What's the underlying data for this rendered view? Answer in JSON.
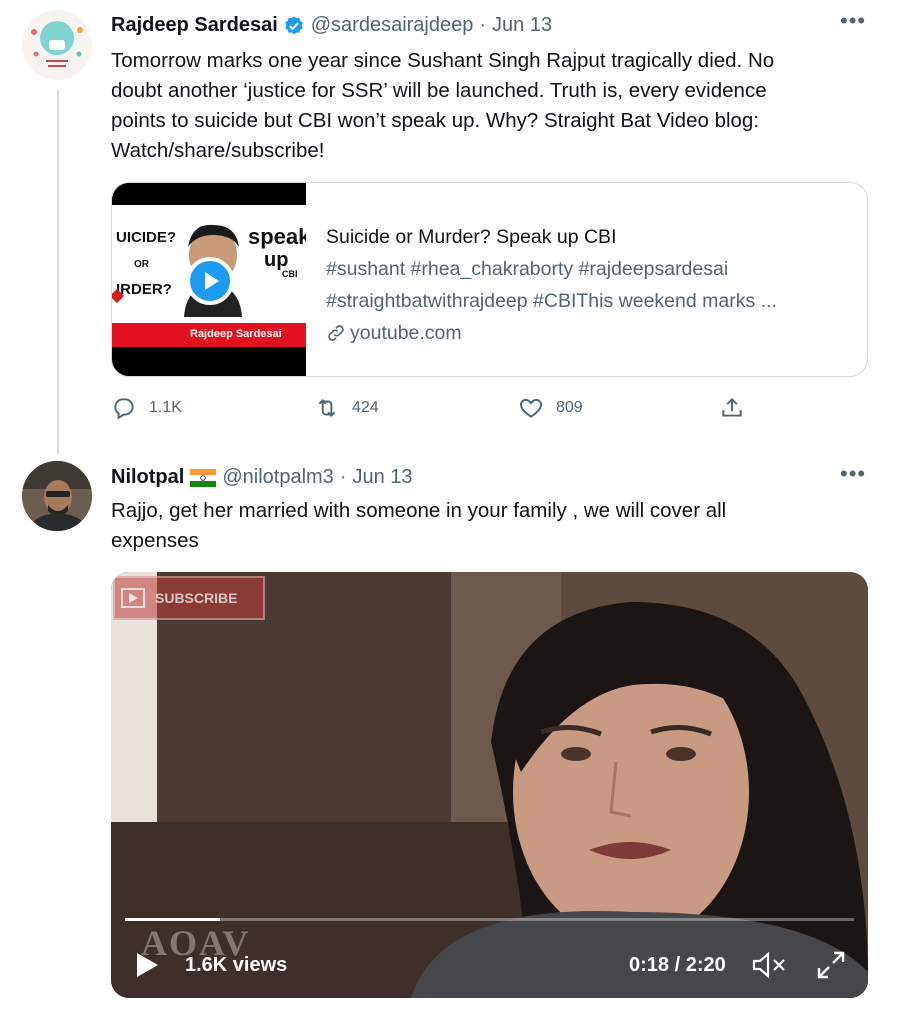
{
  "tweets": [
    {
      "name": "Rajdeep Sardesai",
      "verified": true,
      "handle": "@sardesairajdeep",
      "separator": "·",
      "date": "Jun 13",
      "text_lines": [
        "Tomorrow marks one year since Sushant Singh Rajput tragically died. No",
        "doubt another ‘justice for SSR’ will be launched. Truth is, every evidence",
        "points to suicide but CBI won’t speak up. Why? Straight Bat Video blog:",
        "Watch/share/subscribe!"
      ],
      "card": {
        "title": "Suicide or Murder? Speak up CBI",
        "description_lines": [
          "#sushant #rhea_chakraborty #rajdeepsardesai",
          "#straightbatwithrajdeep #CBIThis weekend marks ..."
        ],
        "domain": "youtube.com",
        "thumbnail": {
          "left_text_1": "UICIDE?",
          "left_text_or": "OR",
          "left_text_2": "IRDER?",
          "right_text_1": "speak",
          "right_text_2": "up",
          "right_text_3": "CBI",
          "banner_text": "Rajdeep Sardesai"
        }
      },
      "actions": {
        "replies": "1.1K",
        "retweets": "424",
        "likes": "809"
      }
    },
    {
      "name": "Nilotpal",
      "flag": "🇮🇳",
      "handle": "@nilotpalm3",
      "separator": "·",
      "date": "Jun 13",
      "text_lines": [
        "Rajjo, get her married with someone in your family , we will cover all",
        "expenses"
      ],
      "video": {
        "subscribe_text": "SUBSCRIBE",
        "watermark": "AOAV",
        "views": "1.6K views",
        "time": "0:18 / 2:20",
        "progress": 0.13
      }
    }
  ],
  "icons": {
    "more": "more-horizontal-icon",
    "verified": "verified-badge-icon",
    "reply": "reply-icon",
    "retweet": "retweet-icon",
    "like": "heart-icon",
    "share": "share-icon",
    "link": "link-icon",
    "play": "play-icon",
    "mute": "mute-icon",
    "fullscreen": "fullscreen-icon"
  },
  "colors": {
    "accent": "#1d9bf0",
    "secondary_text": "#536471",
    "primary_text": "#0f1419",
    "border": "#cfd9de"
  }
}
